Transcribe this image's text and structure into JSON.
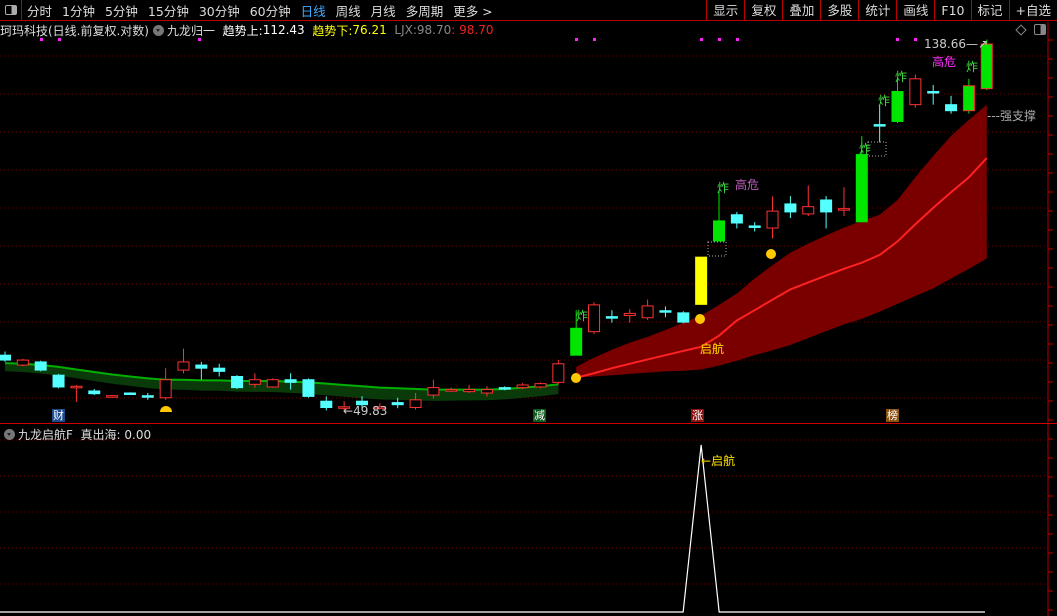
{
  "toolbar": {
    "periods": [
      "分时",
      "1分钟",
      "5分钟",
      "15分钟",
      "30分钟",
      "60分钟",
      "日线",
      "周线",
      "月线",
      "多周期",
      "更多 >"
    ],
    "active": "日线",
    "right": [
      "显示",
      "复权",
      "叠加",
      "多股",
      "统计",
      "画线",
      "F10",
      "标记",
      "+自选"
    ]
  },
  "info": {
    "stock": "珂玛科技(日线.前复权.对数)",
    "indicator": "九龙归一",
    "trend_up_label": "趋势上:",
    "trend_up": "112.43",
    "trend_down_label": "趋势下:",
    "trend_down": "76.21",
    "ljx_label": "LJX:",
    "ljx": "98.70",
    "ljx2": ": 98.70"
  },
  "sub": {
    "indicator": "九龙启航F",
    "value_label": "真出海:",
    "value": "0.00",
    "spike_label": "启航"
  },
  "labels": {
    "high": "138.66",
    "low": "49.83",
    "support": "强支撑",
    "danger": "高危",
    "launch": "启航",
    "boom": "炸",
    "cai": "财",
    "jian": "减",
    "zhang": "涨",
    "bang": "榜"
  },
  "colors": {
    "up": "#ff3232",
    "down": "#54ffff",
    "limit": "#00e600",
    "special": "#ffff00",
    "band": "#7a0000",
    "midline": "#ff2020",
    "greenline": "#00b000"
  },
  "chart_data": {
    "type": "candlestick",
    "scale": "log",
    "candles": [
      [
        57.9,
        58.5,
        56.8,
        57.1
      ],
      [
        56.3,
        57.3,
        56.1,
        57.1
      ],
      [
        56.8,
        57.0,
        55.3,
        55.5
      ],
      [
        54.7,
        54.9,
        52.7,
        52.9
      ],
      [
        52.8,
        53.2,
        50.7,
        53.0
      ],
      [
        52.3,
        52.6,
        51.7,
        51.9
      ],
      [
        51.5,
        51.7,
        51.4,
        51.6
      ],
      [
        52.0,
        52.1,
        51.7,
        51.8
      ],
      [
        51.6,
        52.0,
        51.0,
        51.4
      ],
      [
        51.3,
        55.8,
        51.0,
        54.0
      ],
      [
        55.5,
        59.0,
        55.0,
        56.8
      ],
      [
        56.3,
        56.8,
        54.0,
        55.8
      ],
      [
        55.8,
        56.5,
        54.5,
        55.3
      ],
      [
        54.5,
        54.7,
        52.6,
        52.8
      ],
      [
        53.3,
        55.0,
        52.8,
        54.0
      ],
      [
        52.9,
        54.2,
        52.8,
        54.0
      ],
      [
        54.0,
        55.0,
        52.5,
        53.6
      ],
      [
        54.0,
        54.2,
        51.3,
        51.5
      ],
      [
        50.8,
        51.5,
        49.5,
        49.9
      ],
      [
        49.9,
        50.8,
        49.5,
        50.0
      ],
      [
        50.8,
        51.5,
        49.6,
        50.3
      ],
      [
        49.9,
        50.5,
        49.6,
        50.0
      ],
      [
        50.6,
        51.3,
        49.8,
        50.3
      ],
      [
        49.9,
        52.0,
        49.6,
        51.0
      ],
      [
        51.7,
        54.0,
        51.2,
        52.8
      ],
      [
        52.4,
        52.8,
        52.2,
        52.5
      ],
      [
        52.2,
        53.2,
        52.0,
        52.5
      ],
      [
        52.0,
        53.0,
        51.5,
        52.5
      ],
      [
        52.8,
        53.0,
        52.4,
        52.6
      ],
      [
        52.8,
        53.5,
        52.6,
        53.2
      ],
      [
        52.9,
        53.6,
        52.7,
        53.4
      ],
      [
        53.6,
        57.1,
        53.3,
        56.5
      ],
      [
        57.9,
        65.8,
        57.9,
        62.5
      ],
      [
        61.9,
        67.3,
        61.5,
        66.8
      ],
      [
        64.6,
        65.8,
        63.5,
        64.4
      ],
      [
        64.8,
        66.0,
        63.5,
        65.2
      ],
      [
        64.4,
        67.8,
        64.0,
        66.6
      ],
      [
        65.7,
        66.5,
        64.5,
        65.5
      ],
      [
        65.3,
        65.6,
        63.4,
        63.6
      ],
      [
        66.9,
        76.5,
        66.9,
        76.5
      ],
      [
        80.1,
        92.5,
        80.0,
        84.8
      ],
      [
        86.3,
        87.0,
        83.0,
        84.3
      ],
      [
        83.6,
        84.5,
        82.3,
        83.4
      ],
      [
        83.1,
        90.9,
        80.7,
        87.2
      ],
      [
        89.0,
        91.0,
        85.5,
        87.0
      ],
      [
        86.5,
        93.8,
        86.0,
        88.3
      ],
      [
        90.0,
        91.0,
        83.0,
        87.0
      ],
      [
        87.6,
        93.3,
        86.0,
        87.8
      ],
      [
        84.6,
        107.9,
        84.6,
        102.4
      ],
      [
        111.5,
        117.7,
        106.0,
        111.2
      ],
      [
        112.5,
        127.4,
        112.0,
        122.5
      ],
      [
        118.0,
        128.5,
        117.0,
        127.0
      ],
      [
        122.5,
        124.8,
        118.0,
        122.3
      ],
      [
        118.0,
        121.0,
        115.0,
        116.0
      ],
      [
        116.0,
        127.0,
        115.0,
        124.5
      ],
      [
        123.5,
        142.0,
        123.0,
        140.2
      ]
    ],
    "limit_up_index": [
      32,
      40,
      48,
      50,
      54,
      55
    ],
    "special_index": [
      39
    ],
    "band": {
      "start": 32,
      "upper": [
        56.0,
        57.5,
        58.8,
        60,
        61,
        62.2,
        63.5,
        64.8,
        66.8,
        69,
        72,
        74.8,
        77.5,
        79.5,
        81.4,
        83.2,
        84.8,
        86.3,
        90,
        96,
        102,
        108,
        113,
        118
      ],
      "mid": [
        54.3,
        55,
        55.8,
        56.5,
        57.2,
        57.9,
        58.6,
        59.3,
        61.2,
        63.9,
        65.8,
        67.8,
        69.8,
        71.2,
        72.6,
        74,
        75.3,
        77,
        80,
        84,
        88,
        92,
        96,
        101.4
      ],
      "lower": [
        54.3,
        54.5,
        54.7,
        54.9,
        55.1,
        55.3,
        55.4,
        55.6,
        56.2,
        57,
        57.9,
        58.7,
        59.6,
        60.8,
        62,
        63.2,
        64.2,
        65.5,
        67,
        68.5,
        70,
        72,
        74,
        76.2
      ]
    },
    "green_line": [
      56.6,
      56.5,
      56.3,
      56.0,
      55.6,
      55.2,
      54.8,
      54.5,
      54.2,
      54.0,
      54.0,
      53.9,
      53.9,
      53.8,
      53.8,
      53.8,
      53.7,
      53.6,
      53.4,
      53.2,
      53.0,
      52.8,
      52.7,
      52.6,
      52.5,
      52.5,
      52.5,
      52.5,
      52.6,
      52.8,
      53.0,
      53.3
    ],
    "sub_series": {
      "spike_index": 39,
      "values_peak": 1,
      "baseline": 0
    }
  }
}
